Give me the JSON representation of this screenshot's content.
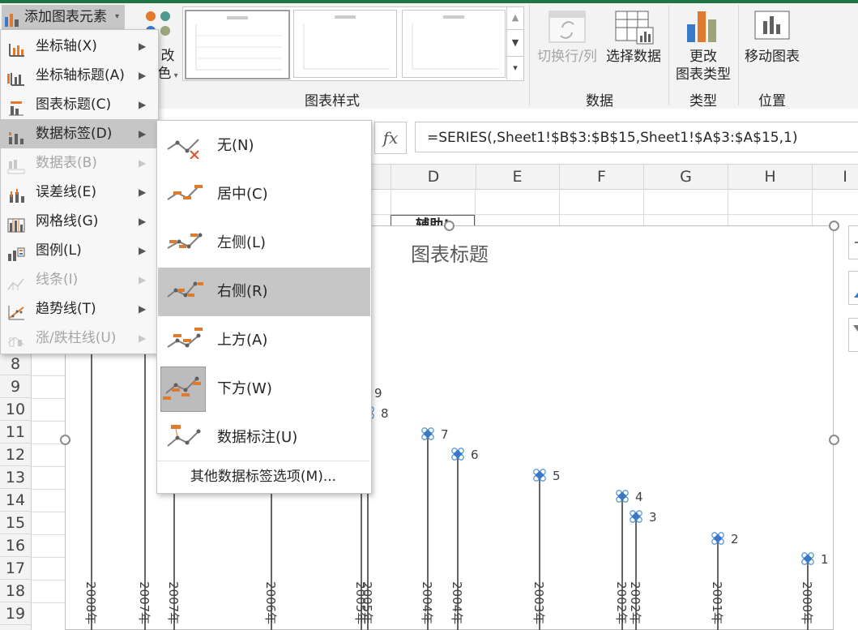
{
  "ribbon": {
    "add_element_label": "添加图表元素",
    "change_colors_line1": "改",
    "change_colors_line2": "色",
    "chart_styles_group": "图表样式",
    "switch_row_col": "切换行/列",
    "select_data": "选择数据",
    "data_group": "数据",
    "change_type_line1": "更改",
    "change_type_line2": "图表类型",
    "type_group": "类型",
    "move_chart": "移动图表",
    "location_group": "位置"
  },
  "formula_bar": {
    "fx": "fx",
    "formula": "=SERIES(,Sheet1!$B$3:$B$15,Sheet1!$A$3:$A$15,1)"
  },
  "columns": [
    "D",
    "E",
    "F",
    "G",
    "H",
    "I"
  ],
  "rows": [
    "8",
    "9",
    "10",
    "11",
    "12",
    "13",
    "14",
    "15",
    "16",
    "17",
    "18",
    "19"
  ],
  "cell_snippet": "辅助!",
  "menu1": {
    "items": [
      {
        "label": "坐标轴(X)",
        "enabled": true
      },
      {
        "label": "坐标轴标题(A)",
        "enabled": true
      },
      {
        "label": "图表标题(C)",
        "enabled": true
      },
      {
        "label": "数据标签(D)",
        "enabled": true
      },
      {
        "label": "数据表(B)",
        "enabled": false
      },
      {
        "label": "误差线(E)",
        "enabled": true
      },
      {
        "label": "网格线(G)",
        "enabled": true
      },
      {
        "label": "图例(L)",
        "enabled": true
      },
      {
        "label": "线条(I)",
        "enabled": false
      },
      {
        "label": "趋势线(T)",
        "enabled": true
      },
      {
        "label": "涨/跌柱线(U)",
        "enabled": false
      }
    ]
  },
  "menu2": {
    "items": [
      {
        "label": "无(N)"
      },
      {
        "label": "居中(C)"
      },
      {
        "label": "左侧(L)"
      },
      {
        "label": "右侧(R)"
      },
      {
        "label": "上方(A)"
      },
      {
        "label": "下方(W)"
      },
      {
        "label": "数据标注(U)"
      }
    ],
    "more": "其他数据标签选项(M)..."
  },
  "chart": {
    "title": "图表标题",
    "x_labels": [
      "2008年",
      "2007年",
      "2007年",
      "2006年",
      "2005年",
      "2005年",
      "2004年",
      "2004年",
      "2003年",
      "2002年",
      "2002年",
      "2001年",
      "2000年"
    ]
  },
  "chart_data": {
    "type": "scatter",
    "title": "图表标题",
    "points": [
      {
        "label": "1"
      },
      {
        "label": "2"
      },
      {
        "label": "3"
      },
      {
        "label": "4"
      },
      {
        "label": "5"
      },
      {
        "label": "6"
      },
      {
        "label": "7"
      },
      {
        "label": "8"
      },
      {
        "label": "9"
      }
    ]
  },
  "colors": {
    "accent_green": "#217346",
    "highlight_gray": "#c6c6c6",
    "marker_blue": "#3a78c8",
    "icon_orange": "#e07a2e"
  }
}
